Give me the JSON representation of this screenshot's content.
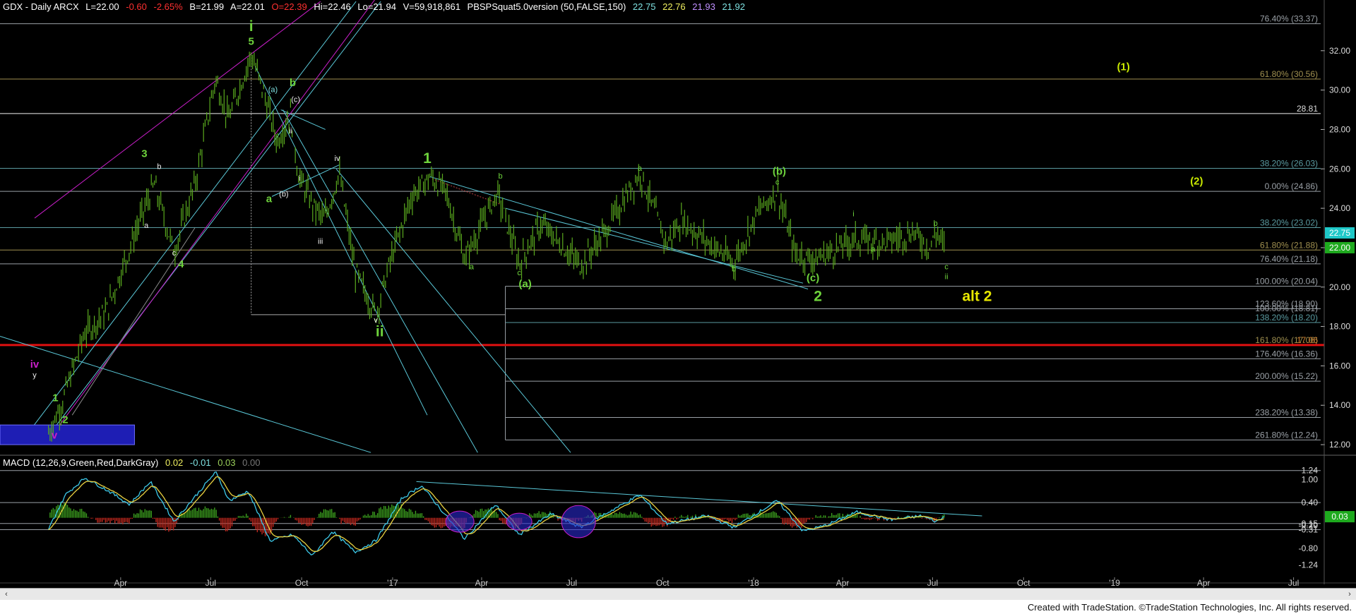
{
  "header": {
    "symbol": "GDX - Daily  ARCX",
    "last": "L=22.00",
    "change": "-0.60",
    "change_pct": "-2.65%",
    "bid": "B=21.99",
    "ask": "A=22.01",
    "open": "O=22.39",
    "high": "Hi=22.46",
    "low": "Lo=21.94",
    "volume": "V=59,918,861",
    "study": "PBSPSquat5.0version (50,FALSE,150)",
    "study_values": [
      "22.75",
      "22.76",
      "21.93",
      "21.92"
    ],
    "study_colors": [
      "#7ee0e0",
      "#f0f060",
      "#c090ff",
      "#7ee0e0"
    ]
  },
  "macd": {
    "label": "MACD (12,26,9,Green,Red,DarkGray)",
    "values": [
      "0.02",
      "-0.01",
      "0.03",
      "0.00"
    ],
    "value_colors": [
      "#f0f060",
      "#7ee0e0",
      "#9ad05a",
      "#777777"
    ]
  },
  "colors": {
    "price_bar": "#5aaa1e",
    "wave_green": "#6ed33c",
    "fib_line": "#9aa0a6",
    "channel": "#5ac8d8",
    "magenta": "#c81ec8",
    "red_line": "#e01010",
    "macd_line": "#3cc8e8",
    "signal_line": "#e8d040",
    "hist_pos": "#3ca01e",
    "hist_neg": "#c0281e"
  },
  "chart_data": {
    "type": "ohlc",
    "symbol": "GDX",
    "interval": "Daily",
    "ylim": [
      11.5,
      34.0
    ],
    "right_axis_ticks": [
      "32.00",
      "30.00",
      "28.00",
      "26.00",
      "24.00",
      "22.00",
      "20.00",
      "18.00",
      "16.00",
      "14.00",
      "12.00"
    ],
    "x_labels": [
      "Apr",
      "Jul",
      "Oct",
      "'17",
      "Apr",
      "Jul",
      "Oct",
      "'18",
      "Apr",
      "Jul",
      "Oct",
      "'19",
      "Apr",
      "Jul"
    ],
    "price_path": [
      {
        "date": "2016-01-19",
        "price": 12.6
      },
      {
        "date": "2016-02-01",
        "price": 14.0
      },
      {
        "date": "2016-02-24",
        "price": 17.6
      },
      {
        "date": "2016-03-18",
        "price": 18.8
      },
      {
        "date": "2016-04-22",
        "price": 23.6
      },
      {
        "date": "2016-05-05",
        "price": 25.2
      },
      {
        "date": "2016-05-25",
        "price": 21.8
      },
      {
        "date": "2016-06-15",
        "price": 25.2
      },
      {
        "date": "2016-07-06",
        "price": 30.6
      },
      {
        "date": "2016-07-19",
        "price": 28.5
      },
      {
        "date": "2016-08-11",
        "price": 31.8
      },
      {
        "date": "2016-08-24",
        "price": 29.8
      },
      {
        "date": "2016-09-06",
        "price": 27.4
      },
      {
        "date": "2016-09-20",
        "price": 28.8
      },
      {
        "date": "2016-09-28",
        "price": 25.6
      },
      {
        "date": "2016-10-12",
        "price": 24.2
      },
      {
        "date": "2016-10-24",
        "price": 23.4
      },
      {
        "date": "2016-11-08",
        "price": 25.8
      },
      {
        "date": "2016-11-24",
        "price": 20.8
      },
      {
        "date": "2016-12-15",
        "price": 18.6
      },
      {
        "date": "2016-12-29",
        "price": 21.2
      },
      {
        "date": "2017-01-20",
        "price": 24.6
      },
      {
        "date": "2017-02-08",
        "price": 25.6
      },
      {
        "date": "2017-02-24",
        "price": 24.8
      },
      {
        "date": "2017-03-15",
        "price": 21.4
      },
      {
        "date": "2017-04-17",
        "price": 24.8
      },
      {
        "date": "2017-05-09",
        "price": 21.2
      },
      {
        "date": "2017-05-31",
        "price": 23.2
      },
      {
        "date": "2017-07-10",
        "price": 21.1
      },
      {
        "date": "2017-08-04",
        "price": 22.8
      },
      {
        "date": "2017-09-08",
        "price": 25.8
      },
      {
        "date": "2017-10-05",
        "price": 22.2
      },
      {
        "date": "2017-10-20",
        "price": 23.4
      },
      {
        "date": "2017-12-12",
        "price": 21.2
      },
      {
        "date": "2018-01-05",
        "price": 23.8
      },
      {
        "date": "2018-01-25",
        "price": 24.9
      },
      {
        "date": "2018-02-12",
        "price": 21.7
      },
      {
        "date": "2018-03-05",
        "price": 21.4
      },
      {
        "date": "2018-04-12",
        "price": 22.4
      },
      {
        "date": "2018-05-15",
        "price": 22.3
      },
      {
        "date": "2018-06-12",
        "price": 22.8
      },
      {
        "date": "2018-06-28",
        "price": 22.0
      },
      {
        "date": "2018-07-05",
        "price": 22.8
      },
      {
        "date": "2018-07-13",
        "price": 22.0
      }
    ],
    "horizontal_levels": [
      {
        "label": "76.40% (33.37)",
        "value": 33.37,
        "color": "#9aa0a6"
      },
      {
        "label": "61.80% (30.56)",
        "value": 30.56,
        "color": "#a09050"
      },
      {
        "label": "28.81",
        "value": 28.81,
        "color": "#cccccc"
      },
      {
        "label": "38.20% (26.03)",
        "value": 26.03,
        "color": "#5a9aa0"
      },
      {
        "label": "0.00% (24.86)",
        "value": 24.86,
        "color": "#9aa0a6"
      },
      {
        "label": "38.20% (23.02)",
        "value": 23.02,
        "color": "#5a9aa0"
      },
      {
        "label": "61.80% (21.88)",
        "value": 21.88,
        "color": "#a09050"
      },
      {
        "label": "76.40% (21.18)",
        "value": 21.18,
        "color": "#9aa0a6"
      },
      {
        "label": "100.00% (20.04)",
        "value": 20.04,
        "color": "#9aa0a6"
      },
      {
        "label": "123.60% (18.90)",
        "value": 18.9,
        "color": "#9aa0a6"
      },
      {
        "label": "138.20% (18.20)",
        "value": 18.2,
        "color": "#5a9aa0"
      },
      {
        "label": "161.80% (17.06)",
        "value": 17.06,
        "color": "#a09050"
      },
      {
        "label": "176.40% (16.36)",
        "value": 16.36,
        "color": "#9aa0a6"
      },
      {
        "label": "200.00% (15.22)",
        "value": 15.22,
        "color": "#9aa0a6"
      },
      {
        "label": "238.20% (13.38)",
        "value": 13.38,
        "color": "#9aa0a6"
      },
      {
        "label": "261.80% (12.24)",
        "value": 12.24,
        "color": "#9aa0a6"
      }
    ],
    "hidden_label": "100.00% (18.81)",
    "red_line_value": 17.06,
    "red_line_label": "17.06",
    "last_price_flags": [
      {
        "label": "22.75",
        "value": 22.75,
        "color": "#1ec8c8"
      },
      {
        "label": "22.00",
        "value": 22.0,
        "color": "#1eaa1e"
      }
    ],
    "wave_labels": [
      {
        "text": "i",
        "date": "2016-08-11",
        "price": 33.0,
        "color": "#6ed33c",
        "size": "xl"
      },
      {
        "text": "5",
        "date": "2016-08-11",
        "price": 32.3,
        "color": "#6ed33c",
        "size": "lg"
      },
      {
        "text": "(a)",
        "date": "2016-09-02",
        "price": 29.9,
        "color": "#7ee0e0",
        "size": "sm"
      },
      {
        "text": "b",
        "date": "2016-09-22",
        "price": 30.2,
        "color": "#6ed33c",
        "size": "lg"
      },
      {
        "text": "(c)",
        "date": "2016-09-25",
        "price": 29.4,
        "color": "#eeeeee",
        "size": "sm"
      },
      {
        "text": "ii",
        "date": "2016-09-20",
        "price": 27.8,
        "color": "#eeeeee",
        "size": "sm"
      },
      {
        "text": "iv",
        "date": "2016-11-06",
        "price": 26.4,
        "color": "#eeeeee",
        "size": "sm"
      },
      {
        "text": "i",
        "date": "2016-09-29",
        "price": 25.4,
        "color": "#eeeeee",
        "size": "sm"
      },
      {
        "text": "(b)",
        "date": "2016-09-13",
        "price": 24.6,
        "color": "#eeeeee",
        "size": "sm"
      },
      {
        "text": "a",
        "date": "2016-08-29",
        "price": 24.3,
        "color": "#6ed33c",
        "size": "lg"
      },
      {
        "text": "iii",
        "date": "2016-10-20",
        "price": 22.2,
        "color": "#eeeeee",
        "size": "sm"
      },
      {
        "text": "v",
        "date": "2016-12-15",
        "price": 18.2,
        "color": "#eeeeee",
        "size": "sm"
      },
      {
        "text": "ii",
        "date": "2016-12-19",
        "price": 17.5,
        "color": "#6ed33c",
        "size": "xl"
      },
      {
        "text": "3",
        "date": "2016-04-25",
        "price": 26.6,
        "color": "#6ed33c",
        "size": "lg"
      },
      {
        "text": "b",
        "date": "2016-05-10",
        "price": 26.0,
        "color": "#eeeeee",
        "size": "sm"
      },
      {
        "text": "a",
        "date": "2016-04-27",
        "price": 23.0,
        "color": "#eeeeee",
        "size": "sm"
      },
      {
        "text": "c",
        "date": "2016-05-25",
        "price": 21.6,
        "color": "#eeeeee",
        "size": "sm"
      },
      {
        "text": "4",
        "date": "2016-06-01",
        "price": 21.0,
        "color": "#6ed33c",
        "size": "lg"
      },
      {
        "text": "iv",
        "date": "2016-01-05",
        "price": 15.9,
        "color": "#c81ec8",
        "size": "lg"
      },
      {
        "text": "y",
        "date": "2016-01-05",
        "price": 15.4,
        "color": "#eeeeee",
        "size": "sm"
      },
      {
        "text": "1",
        "date": "2016-01-26",
        "price": 14.2,
        "color": "#6ed33c",
        "size": "lg"
      },
      {
        "text": "2",
        "date": "2016-02-05",
        "price": 13.1,
        "color": "#6ed33c",
        "size": "lg"
      },
      {
        "text": "v",
        "date": "2016-01-25",
        "price": 12.3,
        "color": "#c81ec8",
        "size": "lg"
      },
      {
        "text": "1",
        "date": "2017-02-05",
        "price": 26.3,
        "color": "#6ed33c",
        "size": "xl"
      },
      {
        "text": "b",
        "date": "2017-04-20",
        "price": 25.5,
        "color": "#6ed33c",
        "size": "sm"
      },
      {
        "text": "a",
        "date": "2017-03-22",
        "price": 20.9,
        "color": "#6ed33c",
        "size": "sm"
      },
      {
        "text": "c",
        "date": "2017-05-09",
        "price": 20.6,
        "color": "#6ed33c",
        "size": "sm"
      },
      {
        "text": "(a)",
        "date": "2017-05-15",
        "price": 20.0,
        "color": "#6ed33c",
        "size": "lg"
      },
      {
        "text": "a",
        "date": "2017-09-08",
        "price": 25.9,
        "color": "#6ed33c",
        "size": "sm"
      },
      {
        "text": "b",
        "date": "2017-12-12",
        "price": 20.8,
        "color": "#6ed33c",
        "size": "sm"
      },
      {
        "text": "(b)",
        "date": "2018-01-27",
        "price": 25.7,
        "color": "#6ed33c",
        "size": "lg"
      },
      {
        "text": "c",
        "date": "2018-01-25",
        "price": 25.2,
        "color": "#6ed33c",
        "size": "sm"
      },
      {
        "text": "(c)",
        "date": "2018-03-02",
        "price": 20.3,
        "color": "#6ed33c",
        "size": "lg"
      },
      {
        "text": "2",
        "date": "2018-03-07",
        "price": 19.3,
        "color": "#6ed33c",
        "size": "xl"
      },
      {
        "text": "i",
        "date": "2018-04-12",
        "price": 23.6,
        "color": "#6ed33c",
        "size": "sm"
      },
      {
        "text": "a",
        "date": "2018-05-02",
        "price": 21.8,
        "color": "#6ed33c",
        "size": "sm"
      },
      {
        "text": "b",
        "date": "2018-07-04",
        "price": 23.1,
        "color": "#6ed33c",
        "size": "sm"
      },
      {
        "text": "c",
        "date": "2018-07-15",
        "price": 20.9,
        "color": "#6ed33c",
        "size": "sm"
      },
      {
        "text": "ii",
        "date": "2018-07-15",
        "price": 20.4,
        "color": "#6ed33c",
        "size": "sm"
      },
      {
        "text": "alt 2",
        "date": "2018-08-15",
        "price": 19.3,
        "color": "#e8e800",
        "size": "xl"
      },
      {
        "text": "(1)",
        "date": "2019-01-10",
        "price": 31.0,
        "color": "#c8e800",
        "size": "lg"
      },
      {
        "text": "(2)",
        "date": "2019-03-25",
        "price": 25.2,
        "color": "#c8e800",
        "size": "lg"
      }
    ],
    "macd_axis": {
      "ylim": [
        -1.45,
        1.55
      ],
      "level_lines": [
        1.24,
        0.4,
        -0.15,
        -0.31
      ],
      "labels": [
        {
          "label": "1.24",
          "value": 1.24
        },
        {
          "label": "1.00",
          "value": 1.0
        },
        {
          "label": "0.40",
          "value": 0.4
        },
        {
          "label": "-0.15",
          "value": -0.15
        },
        {
          "label": "-0.31",
          "value": -0.31
        },
        {
          "label": "-0.20",
          "value": -0.2
        },
        {
          "label": "-0.80",
          "value": -0.8
        },
        {
          "label": "-1.24",
          "value": -1.24
        }
      ],
      "flag": {
        "label": "0.03",
        "value": 0.03
      }
    },
    "macd_path": [
      {
        "date": "2016-01-19",
        "value": -0.3
      },
      {
        "date": "2016-02-05",
        "value": 0.6
      },
      {
        "date": "2016-02-25",
        "value": 1.05
      },
      {
        "date": "2016-03-20",
        "value": 0.7
      },
      {
        "date": "2016-04-10",
        "value": 0.35
      },
      {
        "date": "2016-05-01",
        "value": 0.95
      },
      {
        "date": "2016-05-25",
        "value": -0.1
      },
      {
        "date": "2016-06-15",
        "value": 0.55
      },
      {
        "date": "2016-07-06",
        "value": 1.2
      },
      {
        "date": "2016-07-20",
        "value": 0.45
      },
      {
        "date": "2016-08-08",
        "value": 0.7
      },
      {
        "date": "2016-08-30",
        "value": -0.6
      },
      {
        "date": "2016-09-22",
        "value": -0.45
      },
      {
        "date": "2016-10-12",
        "value": -1.0
      },
      {
        "date": "2016-11-01",
        "value": -0.35
      },
      {
        "date": "2016-11-24",
        "value": -0.9
      },
      {
        "date": "2016-12-15",
        "value": -0.6
      },
      {
        "date": "2017-01-10",
        "value": 0.5
      },
      {
        "date": "2017-01-30",
        "value": 0.85
      },
      {
        "date": "2017-03-15",
        "value": -0.55
      },
      {
        "date": "2017-04-15",
        "value": 0.35
      },
      {
        "date": "2017-05-09",
        "value": -0.45
      },
      {
        "date": "2017-06-10",
        "value": 0.1
      },
      {
        "date": "2017-07-10",
        "value": -0.25
      },
      {
        "date": "2017-09-08",
        "value": 0.6
      },
      {
        "date": "2017-10-05",
        "value": -0.15
      },
      {
        "date": "2017-11-15",
        "value": 0.05
      },
      {
        "date": "2017-12-12",
        "value": -0.25
      },
      {
        "date": "2018-01-25",
        "value": 0.45
      },
      {
        "date": "2018-02-20",
        "value": -0.35
      },
      {
        "date": "2018-03-15",
        "value": -0.2
      },
      {
        "date": "2018-04-15",
        "value": 0.15
      },
      {
        "date": "2018-05-20",
        "value": -0.05
      },
      {
        "date": "2018-06-20",
        "value": 0.05
      },
      {
        "date": "2018-07-05",
        "value": -0.1
      },
      {
        "date": "2018-07-13",
        "value": 0.03
      }
    ]
  },
  "footer": {
    "credit": "Created with TradeStation. ©TradeStation Technologies, Inc. All rights reserved."
  },
  "scrollbar": {
    "left_arrow": "‹",
    "right_arrow": "›"
  }
}
